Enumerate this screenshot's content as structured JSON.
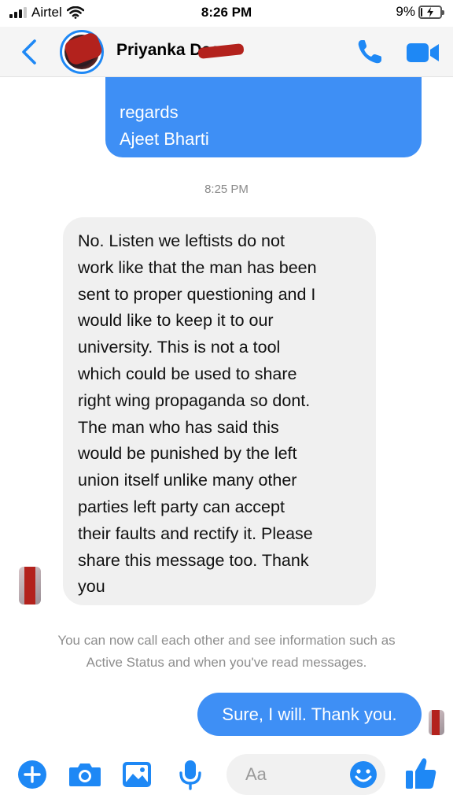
{
  "status_bar": {
    "carrier": "Airtel",
    "time": "8:26 PM",
    "battery": "9%",
    "battery_level": 0.09
  },
  "header": {
    "contact_name": "Priyanka Das"
  },
  "messages": {
    "outgoing_prev_lines": [
      "regards",
      "Ajeet Bharti"
    ],
    "time_divider": "8:25 PM",
    "incoming_lines": [
      "No. Listen we leftists do not",
      "work like that the man has been",
      "sent to proper questioning and I",
      "would like to keep it to our",
      "university. This is not a tool",
      "which could be used to share",
      "right wing propaganda so dont.",
      "The man who has said this",
      "would be punished by the left",
      "union itself unlike many other",
      "parties left party can accept",
      "their faults and rectify it. Please",
      "share this message too. Thank",
      "you"
    ],
    "notice_lines": [
      "You can now call each other and see information such as",
      "Active Status and when you've read messages."
    ],
    "outgoing_reply": "Sure, I will. Thank you."
  },
  "composer": {
    "placeholder": "Aa"
  },
  "colors": {
    "accent": "#1e88f5",
    "bubble_out": "#3e8ff5",
    "bubble_in": "#f0f0f0"
  },
  "icons": [
    "back-chevron-icon",
    "phone-icon",
    "video-camera-icon",
    "plus-icon",
    "camera-icon",
    "image-icon",
    "microphone-icon",
    "emoji-icon",
    "thumbs-up-icon"
  ]
}
